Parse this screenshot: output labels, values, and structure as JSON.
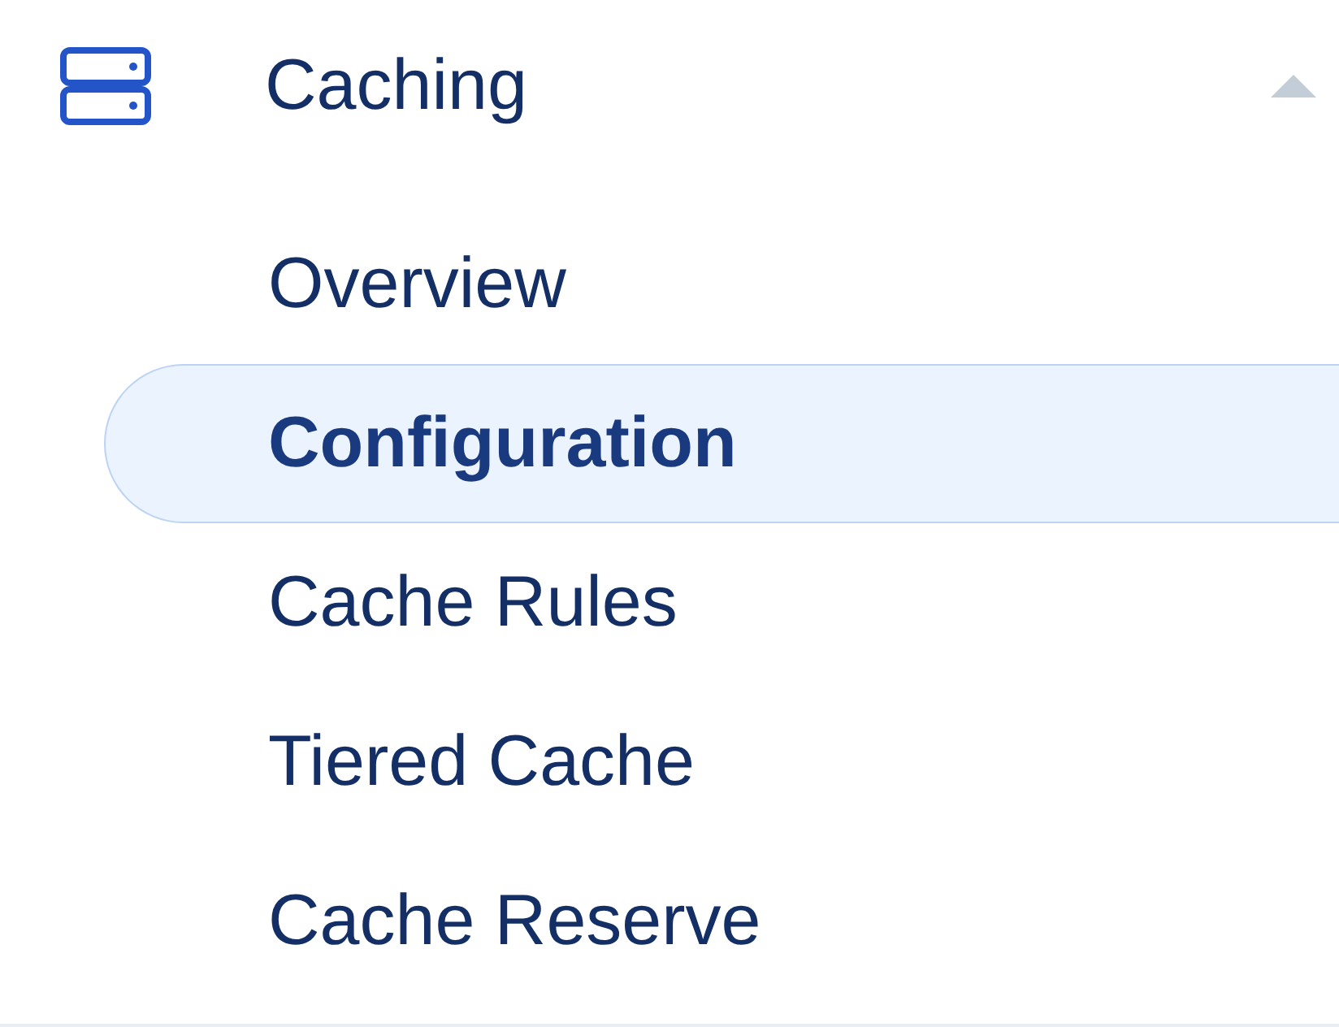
{
  "section": {
    "title": "Caching",
    "expanded": true,
    "items": [
      {
        "label": "Overview",
        "selected": false
      },
      {
        "label": "Configuration",
        "selected": true
      },
      {
        "label": "Cache Rules",
        "selected": false
      },
      {
        "label": "Tiered Cache",
        "selected": false
      },
      {
        "label": "Cache Reserve",
        "selected": false
      }
    ]
  }
}
